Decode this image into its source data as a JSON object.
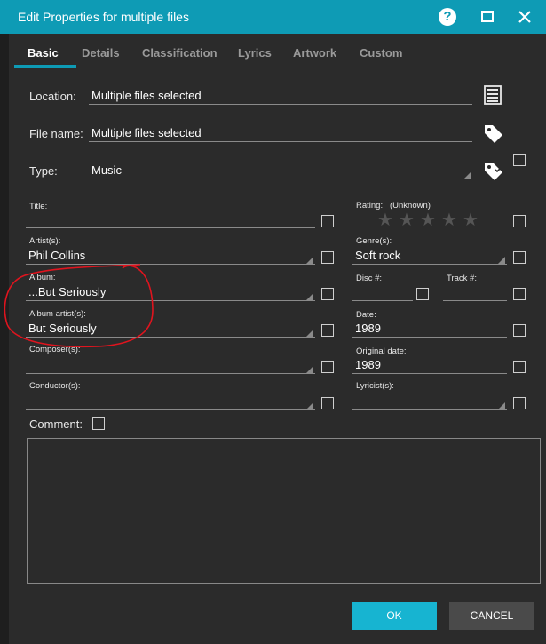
{
  "window": {
    "title": "Edit Properties for multiple files"
  },
  "tabs": [
    {
      "label": "Basic"
    },
    {
      "label": "Details"
    },
    {
      "label": "Classification"
    },
    {
      "label": "Lyrics"
    },
    {
      "label": "Artwork"
    },
    {
      "label": "Custom"
    }
  ],
  "active_tab": "Basic",
  "location": {
    "label": "Location:",
    "value": "Multiple files selected"
  },
  "filename": {
    "label": "File name:",
    "value": "Multiple files selected"
  },
  "type": {
    "label": "Type:",
    "value": "Music"
  },
  "fields": {
    "title": {
      "label": "Title:",
      "value": ""
    },
    "rating": {
      "label": "Rating:",
      "value": "(Unknown)",
      "stars": 0
    },
    "artists": {
      "label": "Artist(s):",
      "value": "Phil Collins"
    },
    "genre": {
      "label": "Genre(s):",
      "value": "Soft rock"
    },
    "album": {
      "label": "Album:",
      "value": "...But Seriously"
    },
    "disc": {
      "label": "Disc #:",
      "value": ""
    },
    "track": {
      "label": "Track #:",
      "value": ""
    },
    "album_artists": {
      "label": "Album artist(s):",
      "value": "But Seriously"
    },
    "date": {
      "label": "Date:",
      "value": "1989"
    },
    "composers": {
      "label": "Composer(s):",
      "value": ""
    },
    "original_date": {
      "label": "Original date:",
      "value": "1989"
    },
    "conductors": {
      "label": "Conductor(s):",
      "value": ""
    },
    "lyricists": {
      "label": "Lyricist(s):",
      "value": ""
    }
  },
  "comment": {
    "label": "Comment:",
    "value": ""
  },
  "buttons": {
    "ok": "OK",
    "cancel": "CANCEL"
  },
  "colors": {
    "accent": "#0e9bb5",
    "annotation": "#e0141e"
  }
}
